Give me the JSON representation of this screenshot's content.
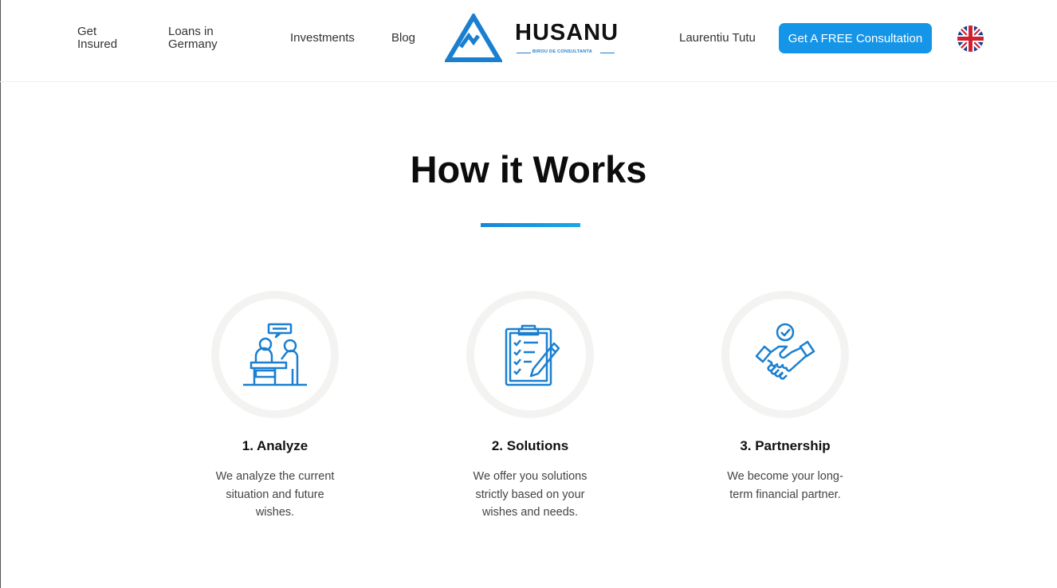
{
  "nav": {
    "get_insured": "Get Insured",
    "loans_in_germany": "Loans in Germany",
    "investments": "Investments",
    "blog": "Blog",
    "person": "Laurentiu Tutu"
  },
  "brand": {
    "name": "HUSANU",
    "tagline": "BIROU DE CONSULTANTA",
    "color": "#1a7fd0"
  },
  "cta": {
    "label": "Get A FREE Consultation",
    "color": "#1595e8"
  },
  "language": {
    "icon": "uk-flag-icon"
  },
  "section": {
    "title": "How it Works"
  },
  "steps": [
    {
      "title": "1. Analyze",
      "description": "We analyze the current situation and future wishes.",
      "icon": "meeting-icon"
    },
    {
      "title": "2. Solutions",
      "description": "We offer you solutions strictly based on your wishes and needs.",
      "icon": "clipboard-checklist-icon"
    },
    {
      "title": "3. Partnership",
      "description": "We become your long-term financial partner.",
      "icon": "handshake-icon"
    }
  ]
}
